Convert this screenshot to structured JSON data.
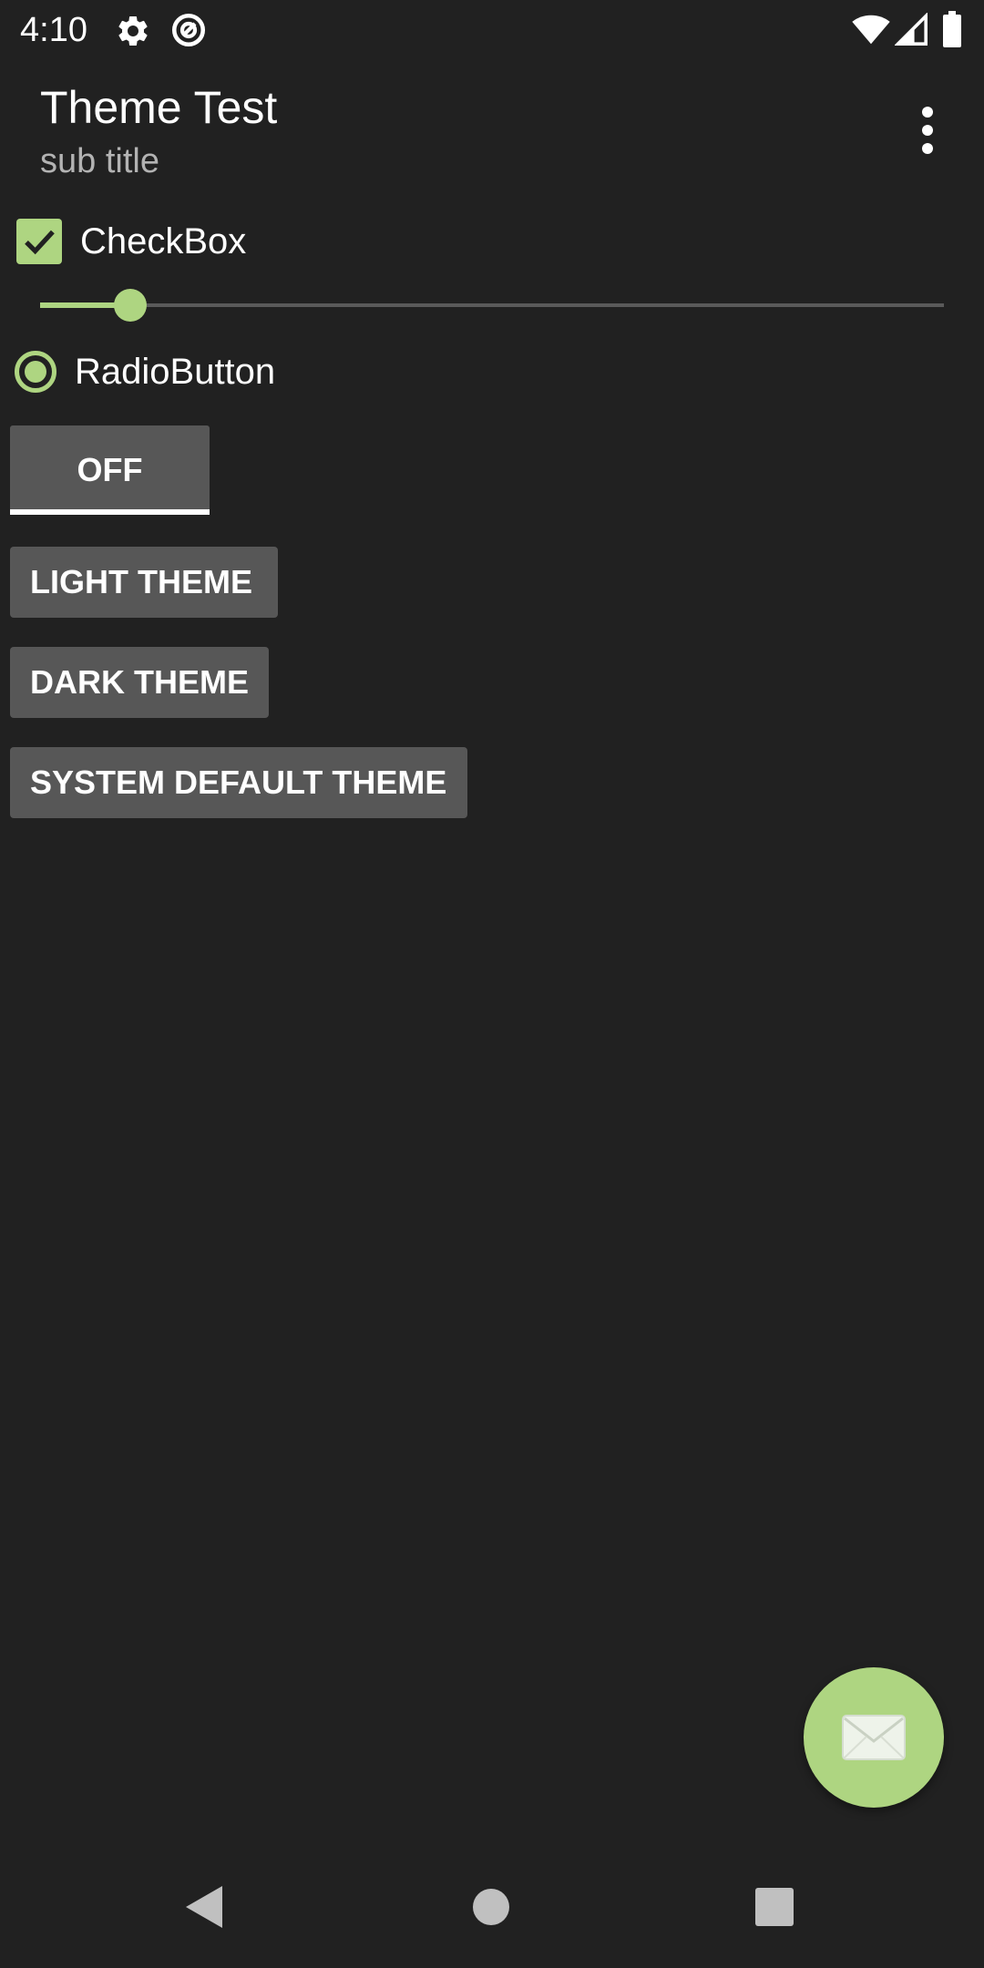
{
  "status_bar": {
    "time": "4:10",
    "icons": [
      "settings-icon",
      "data-saver-icon",
      "wifi-icon",
      "signal-icon",
      "battery-icon"
    ]
  },
  "app_bar": {
    "title": "Theme Test",
    "subtitle": "sub title",
    "menu_icon": "overflow-menu-icon"
  },
  "controls": {
    "checkbox": {
      "label": "CheckBox",
      "checked": true
    },
    "slider": {
      "value": 0.1
    },
    "radio": {
      "label": "RadioButton",
      "selected": true
    },
    "toggle": {
      "label": "OFF"
    }
  },
  "buttons": {
    "light": "LIGHT THEME",
    "dark": "DARK THEME",
    "system": "SYSTEM DEFAULT THEME"
  },
  "fab": {
    "icon": "envelope-icon"
  },
  "nav_bar": {
    "icons": [
      "back-icon",
      "home-icon",
      "recents-icon"
    ]
  },
  "colors": {
    "background": "#212121",
    "accent": "#aed581",
    "button": "#575757",
    "text": "#ffffff",
    "subtitle": "#b3b3b3"
  }
}
